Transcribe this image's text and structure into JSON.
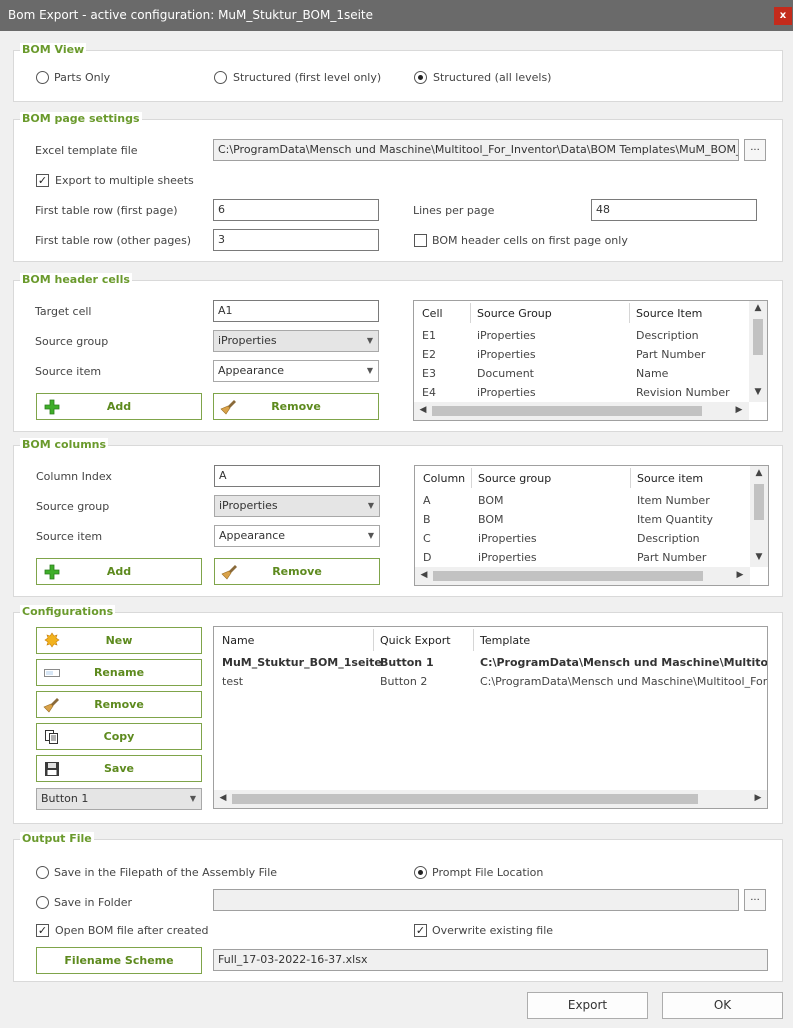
{
  "window": {
    "title": "Bom Export - active configuration: MuM_Stuktur_BOM_1seite",
    "close_label": "x"
  },
  "bom_view": {
    "legend": "BOM View",
    "options": [
      "Parts Only",
      "Structured (first level only)",
      "Structured (all levels)"
    ],
    "selected_index": 2
  },
  "page_settings": {
    "legend": "BOM page settings",
    "excel_template_label": "Excel template file",
    "excel_template_value": "C:\\ProgramData\\Mensch und Maschine\\Multitool_For_Inventor\\Data\\BOM Templates\\MuM_BOM_Stuktur.xlsx",
    "browse_label": "...",
    "export_multi_label": "Export to multiple sheets",
    "export_multi_checked": true,
    "first_row_label": "First table row (first page)",
    "first_row_value": "6",
    "lines_per_page_label": "Lines per page",
    "lines_per_page_value": "48",
    "other_row_label": "First table row (other pages)",
    "other_row_value": "3",
    "header_first_only_label": "BOM header cells on first page only",
    "header_first_only_checked": false
  },
  "header_cells": {
    "legend": "BOM header cells",
    "target_cell_label": "Target cell",
    "target_cell_value": "A1",
    "source_group_label": "Source group",
    "source_group_value": "iProperties",
    "source_item_label": "Source item",
    "source_item_value": "Appearance",
    "add_label": "Add",
    "remove_label": "Remove",
    "columns": [
      "Cell",
      "Source Group",
      "Source Item"
    ],
    "rows": [
      [
        "E1",
        "iProperties",
        "Description"
      ],
      [
        "E2",
        "iProperties",
        "Part Number"
      ],
      [
        "E3",
        "Document",
        "Name"
      ],
      [
        "E4",
        "iProperties",
        "Revision Number"
      ]
    ]
  },
  "bom_columns": {
    "legend": "BOM columns",
    "column_index_label": "Column Index",
    "column_index_value": "A",
    "source_group_label": "Source group",
    "source_group_value": "iProperties",
    "source_item_label": "Source item",
    "source_item_value": "Appearance",
    "add_label": "Add",
    "remove_label": "Remove",
    "columns": [
      "Column",
      "Source group",
      "Source item"
    ],
    "rows": [
      [
        "A",
        "BOM",
        "Item Number"
      ],
      [
        "B",
        "BOM",
        "Item Quantity"
      ],
      [
        "C",
        "iProperties",
        "Description"
      ],
      [
        "D",
        "iProperties",
        "Part Number"
      ]
    ]
  },
  "configurations": {
    "legend": "Configurations",
    "buttons": {
      "new": "New",
      "rename": "Rename",
      "remove": "Remove",
      "copy": "Copy",
      "save": "Save"
    },
    "quick_button_value": "Button 1",
    "columns": [
      "Name",
      "Quick Export",
      "Template"
    ],
    "rows": [
      [
        "MuM_Stuktur_BOM_1seite",
        "Button 1",
        "C:\\ProgramData\\Mensch und Maschine\\Multitool_For_Inventor"
      ],
      [
        "test",
        "Button 2",
        "C:\\ProgramData\\Mensch und Maschine\\Multitool_For_Inventor"
      ]
    ],
    "active_row_index": 0
  },
  "output_file": {
    "legend": "Output File",
    "save_in_assembly_label": "Save in the Filepath of the Assembly File",
    "prompt_location_label": "Prompt File Location",
    "save_in_folder_label": "Save in Folder",
    "selected": "prompt",
    "folder_value": "",
    "browse_label": "...",
    "open_after_label": "Open BOM file after created",
    "open_after_checked": true,
    "overwrite_label": "Overwrite existing file",
    "overwrite_checked": true,
    "filename_scheme_label": "Filename Scheme",
    "filename_value": "Full_17-03-2022-16-37.xlsx"
  },
  "footer": {
    "export_label": "Export",
    "ok_label": "OK"
  },
  "colors": {
    "accent": "#6a9a2c",
    "titlebar": "#6a6a6a",
    "close": "#c42b1c"
  }
}
